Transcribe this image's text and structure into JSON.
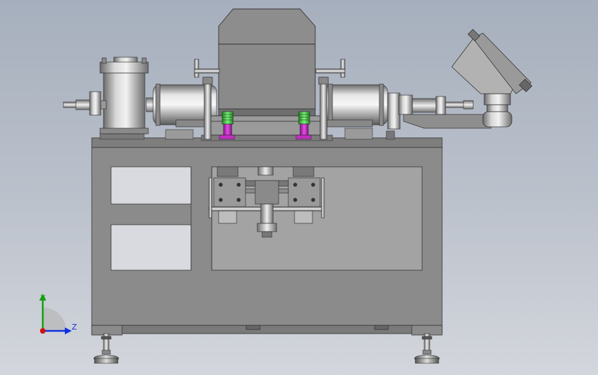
{
  "axes": {
    "y_label": "Y",
    "z_label": "Z",
    "y_color": "#10a010",
    "z_color": "#1030e0",
    "x_color": "#d01010"
  },
  "colors": {
    "background_top": "#a6afbd",
    "background_bottom": "#d3d6dc",
    "frame": "#8b8b8b",
    "frame_dark": "#606060",
    "spring_green": "#3cc43c",
    "clamp_magenta": "#c020c0"
  }
}
